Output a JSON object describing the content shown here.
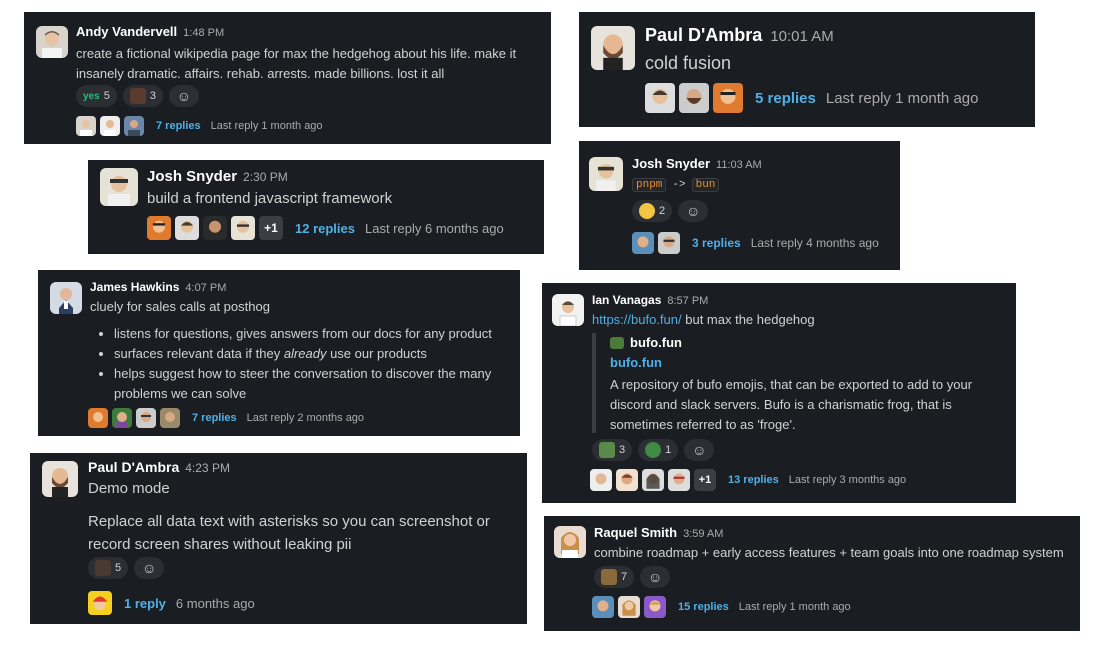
{
  "colors": {
    "bg": "#1a1d21",
    "link": "#4fb0e6",
    "name": "#ffffff",
    "text": "#d1d2d3",
    "muted": "#ababad"
  },
  "msg1": {
    "author": "Andy Vandervell",
    "time": "1:48 PM",
    "text": "create a fictional wikipedia page for max the hedgehog about his life. make it insanely dramatic. affairs. rehab. arrests. made billions. lost it all",
    "reactions": [
      {
        "emoji": "yes-icon",
        "label": "yes",
        "count": "5"
      },
      {
        "emoji": "person-emoji",
        "count": "3"
      }
    ],
    "replies": "7 replies",
    "last": "Last reply 1 month ago"
  },
  "msg2": {
    "author": "Josh Snyder",
    "time": "2:30 PM",
    "text": "build a frontend javascript framework",
    "plus": "+1",
    "replies": "12 replies",
    "last": "Last reply 6 months ago"
  },
  "msg3": {
    "author": "James Hawkins",
    "time": "4:07 PM",
    "text": "cluely for sales calls at posthog",
    "bullets": [
      "listens for questions, gives answers from our docs for any product",
      {
        "pre": "surfaces relevant data if they ",
        "em": "already",
        "post": " use our products"
      },
      "helps suggest how to steer the conversation to discover the many problems we can solve"
    ],
    "replies": "7 replies",
    "last": "Last reply 2 months ago"
  },
  "msg4": {
    "author": "Paul D'Ambra",
    "time": "4:23 PM",
    "title": "Demo mode",
    "text": "Replace all data text with asterisks so you can screenshot or record screen shares without leaking pii",
    "reactions": [
      {
        "emoji": "person-emoji",
        "count": "5"
      }
    ],
    "replies": "1 reply",
    "last": "6 months ago"
  },
  "msg5": {
    "author": "Paul D'Ambra",
    "time": "10:01 AM",
    "text": "cold fusion",
    "replies": "5 replies",
    "last": "Last reply 1 month ago"
  },
  "msg6": {
    "author": "Josh Snyder",
    "time": "11:03 AM",
    "code1": "pnpm",
    "arrow": "->",
    "code2": "bun",
    "reactions": [
      {
        "emoji": "smiley-emoji",
        "count": "2"
      }
    ],
    "replies": "3 replies",
    "last": "Last reply 4 months ago"
  },
  "msg7": {
    "author": "Ian Vanagas",
    "time": "8:57 PM",
    "link": "https://bufo.fun/",
    "text": " but max the hedgehog",
    "unfurl": {
      "site": "bufo.fun",
      "title": "bufo.fun",
      "desc": "A repository of bufo emojis, that can be exported to add to your discord and slack servers. Bufo is a charismatic frog, that is sometimes referred to as 'froge'."
    },
    "reactions": [
      {
        "emoji": "bufo-emoji",
        "count": "3"
      },
      {
        "emoji": "frog-emoji",
        "count": "1"
      }
    ],
    "plus": "+1",
    "replies": "13 replies",
    "last": "Last reply 3 months ago"
  },
  "msg8": {
    "author": "Raquel Smith",
    "time": "3:59 AM",
    "text": "combine roadmap + early access features + team goals into one roadmap system",
    "reactions": [
      {
        "emoji": "map-emoji",
        "count": "7"
      }
    ],
    "replies": "15 replies",
    "last": "Last reply 1 month ago"
  }
}
